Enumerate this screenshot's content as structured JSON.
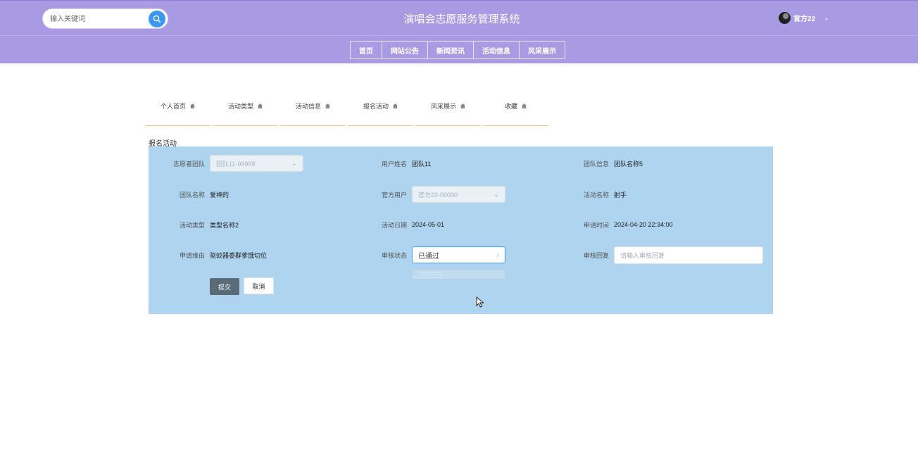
{
  "header": {
    "title": "演唱会志愿服务管理系统",
    "search_placeholder": "输入关键词",
    "username": "官方22"
  },
  "nav": [
    "首页",
    "网站公告",
    "新闻资讯",
    "活动信息",
    "风采展示"
  ],
  "tabs": [
    "个人首页",
    "活动类型",
    "活动信息",
    "报名活动",
    "风采展示",
    "收藏"
  ],
  "section_title": "报名活动",
  "form": {
    "volunteer_team_label": "志愿者团队",
    "volunteer_team_value": "团队11-99999",
    "user_name_label": "用户姓名",
    "user_name_value": "团队11",
    "team_info_label": "团队信息",
    "team_info_value": "团队名称5",
    "team_name_label": "团队名称",
    "team_name_value": "爱神的",
    "official_user_label": "官方用户",
    "official_user_value": "官方22-00000",
    "activity_name_label": "活动名称",
    "activity_name_value": "射手",
    "activity_type_label": "活动类型",
    "activity_type_value": "类型名称2",
    "activity_date_label": "活动日期",
    "activity_date_value": "2024-05-01",
    "apply_time_label": "申请时间",
    "apply_time_value": "2024-04-20 22:34:00",
    "reason_label": "申请缘由",
    "reason_value": "驱蚊器委群爹饿切位",
    "review_status_label": "审核状态",
    "review_status_value": "已通过",
    "review_reply_label": "审核回复",
    "review_reply_placeholder": "请输入审核回复",
    "submit_label": "提交",
    "cancel_label": "取消"
  },
  "colors": {
    "header_bg": "#a99be3",
    "panel_bg": "#aed4ef",
    "search_button": "#3a98f0",
    "submit_button": "#5a6a79",
    "tab_underline": "#f3c98b"
  }
}
